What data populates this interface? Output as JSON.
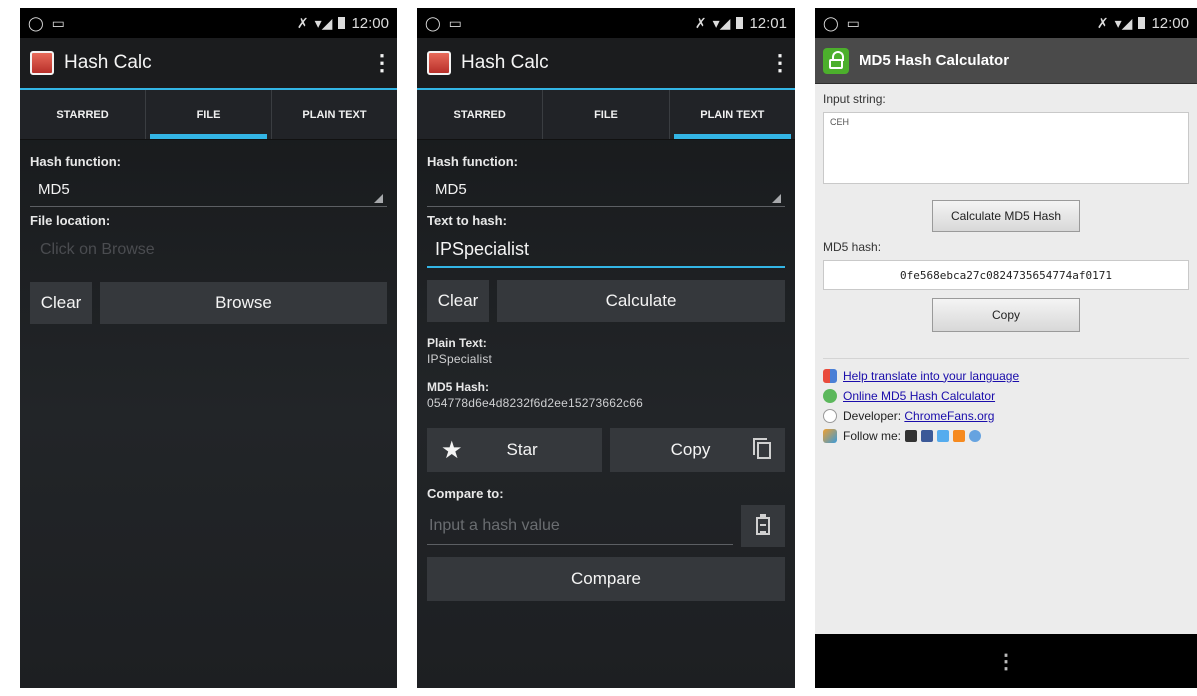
{
  "phone1": {
    "status": {
      "time": "12:00"
    },
    "app_title": "Hash Calc",
    "tabs": [
      "STARRED",
      "FILE",
      "PLAIN TEXT"
    ],
    "hash_function_label": "Hash function:",
    "hash_function_value": "MD5",
    "file_location_label": "File location:",
    "file_location_placeholder": "Click on Browse",
    "clear_label": "Clear",
    "browse_label": "Browse"
  },
  "phone2": {
    "status": {
      "time": "12:01"
    },
    "app_title": "Hash Calc",
    "tabs": [
      "STARRED",
      "FILE",
      "PLAIN TEXT"
    ],
    "hash_function_label": "Hash function:",
    "hash_function_value": "MD5",
    "text_label": "Text to hash:",
    "text_value": "IPSpecialist",
    "clear_label": "Clear",
    "calculate_label": "Calculate",
    "plain_text_label": "Plain Text:",
    "plain_text_value": "IPSpecialist",
    "md5_label": "MD5 Hash:",
    "md5_value": "054778d6e4d8232f6d2ee15273662c66",
    "star_label": "Star",
    "copy_label": "Copy",
    "compare_label": "Compare to:",
    "compare_placeholder": "Input a hash value",
    "compare_button": "Compare"
  },
  "phone3": {
    "status": {
      "time": "12:00"
    },
    "title": "MD5 Hash Calculator",
    "input_label": "Input string:",
    "input_value": "CEH",
    "calc_button": "Calculate MD5 Hash",
    "hash_label": "MD5 hash:",
    "hash_value": "0fe568ebca27c0824735654774af0171",
    "copy_button": "Copy",
    "links": {
      "translate": "Help translate into your language",
      "online": "Online MD5 Hash Calculator",
      "developer_prefix": "Developer: ",
      "developer_link": "ChromeFans.org",
      "follow": "Follow me:"
    }
  },
  "colors": {
    "accent": "#33b5e5",
    "dark_bg": "#1d1f22",
    "button_bg": "#35383c",
    "lock_green": "#4caf2c",
    "link": "#1a0dab"
  }
}
